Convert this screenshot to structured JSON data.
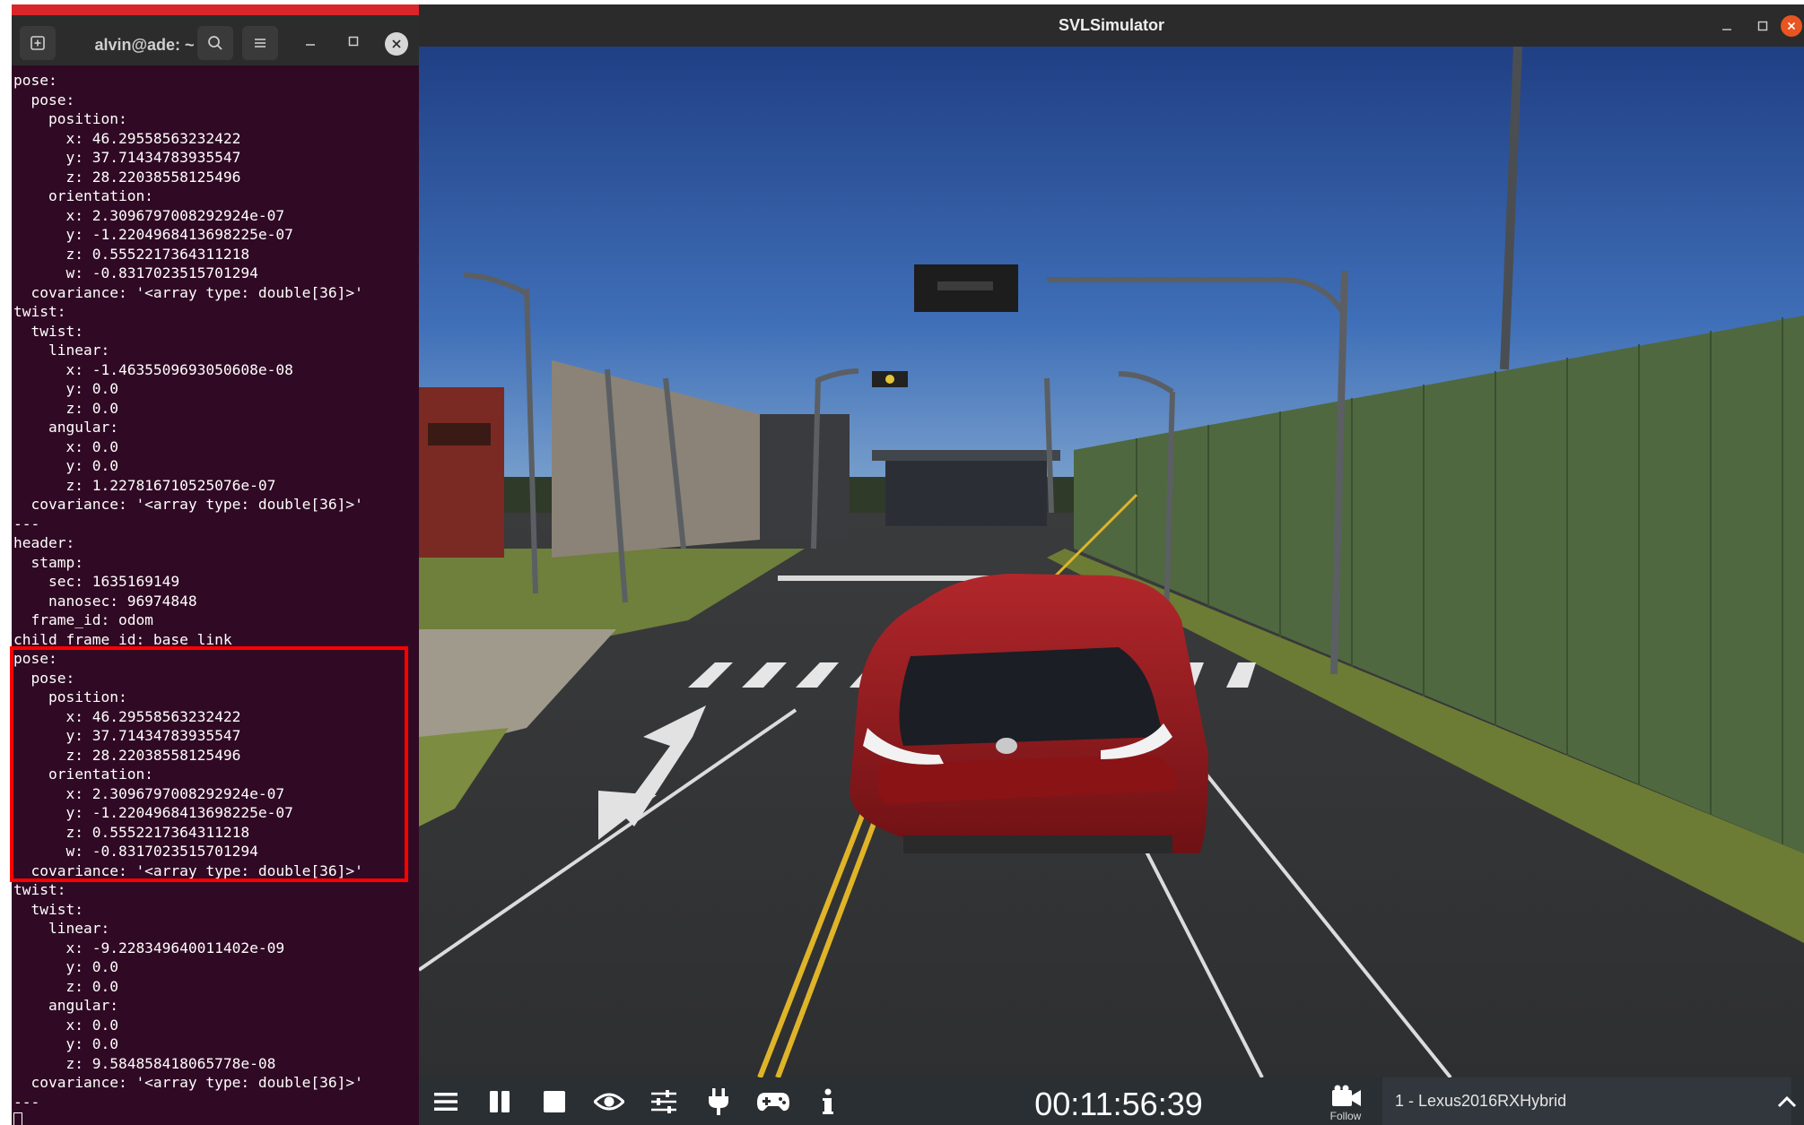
{
  "terminal": {
    "title": "alvin@ade: ~",
    "lines": [
      "pose:",
      "  pose:",
      "    position:",
      "      x: 46.29558563232422",
      "      y: 37.71434783935547",
      "      z: 28.22038558125496",
      "    orientation:",
      "      x: 2.3096797008292924e-07",
      "      y: -1.2204968413698225e-07",
      "      z: 0.5552217364311218",
      "      w: -0.8317023515701294",
      "  covariance: '<array type: double[36]>'",
      "twist:",
      "  twist:",
      "    linear:",
      "      x: -1.4635509693050608e-08",
      "      y: 0.0",
      "      z: 0.0",
      "    angular:",
      "      x: 0.0",
      "      y: 0.0",
      "      z: 1.227816710525076e-07",
      "  covariance: '<array type: double[36]>'",
      "---",
      "header:",
      "  stamp:",
      "    sec: 1635169149",
      "    nanosec: 96974848",
      "  frame_id: odom",
      "child_frame_id: base_link",
      "pose:",
      "  pose:",
      "    position:",
      "      x: 46.29558563232422",
      "      y: 37.71434783935547",
      "      z: 28.22038558125496",
      "    orientation:",
      "      x: 2.3096797008292924e-07",
      "      y: -1.2204968413698225e-07",
      "      z: 0.5552217364311218",
      "      w: -0.8317023515701294",
      "  covariance: '<array type: double[36]>'",
      "twist:",
      "  twist:",
      "    linear:",
      "      x: -9.228349640011402e-09",
      "      y: 0.0",
      "      z: 0.0",
      "    angular:",
      "      x: 0.0",
      "      y: 0.0",
      "      z: 9.584858418065778e-08",
      "  covariance: '<array type: double[36]>'",
      "---"
    ]
  },
  "simulator": {
    "title": "SVLSimulator",
    "timer": "00:11:56:39",
    "follow_label": "Follow",
    "vehicle_label": "1 - Lexus2016RXHybrid"
  },
  "colors": {
    "terminal_bg": "#300a24",
    "highlight": "#ff0000",
    "close_button": "#e95420"
  }
}
